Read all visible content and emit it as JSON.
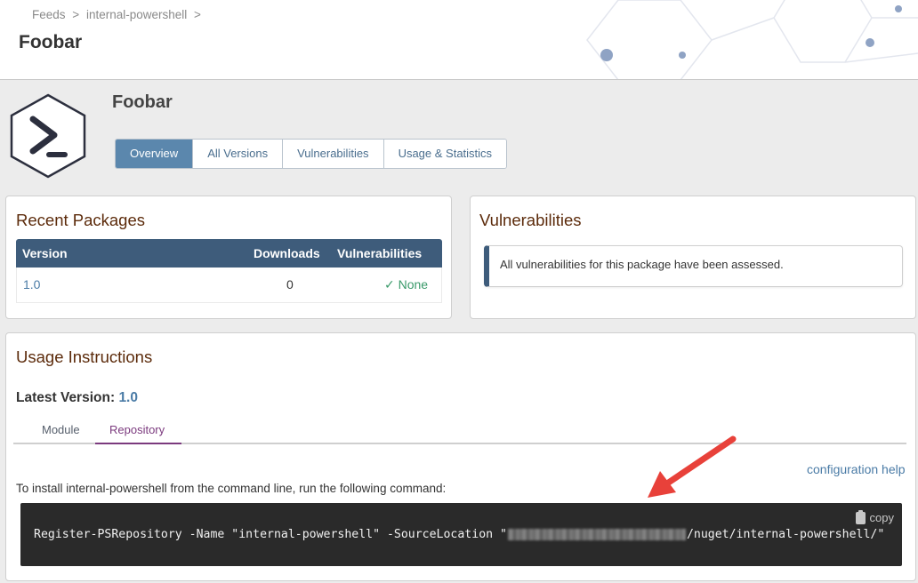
{
  "breadcrumb": {
    "items": [
      "Feeds",
      ">",
      "internal-powershell",
      ">"
    ]
  },
  "page": {
    "title": "Foobar"
  },
  "package": {
    "name": "Foobar",
    "tabs": [
      {
        "label": "Overview",
        "active": true
      },
      {
        "label": "All Versions",
        "active": false
      },
      {
        "label": "Vulnerabilities",
        "active": false
      },
      {
        "label": "Usage & Statistics",
        "active": false
      }
    ]
  },
  "recent": {
    "title": "Recent Packages",
    "columns": [
      "Version",
      "Downloads",
      "Vulnerabilities"
    ],
    "rows": [
      {
        "version": "1.0",
        "downloads": "0",
        "vulnerabilities": "None"
      }
    ]
  },
  "vulnerabilities": {
    "title": "Vulnerabilities",
    "message": "All vulnerabilities for this package have been assessed."
  },
  "usage": {
    "title": "Usage Instructions",
    "latest_label": "Latest Version:",
    "latest_version": "1.0",
    "subtabs": [
      {
        "label": "Module",
        "active": false
      },
      {
        "label": "Repository",
        "active": true
      }
    ],
    "config_help": "configuration help",
    "install_text": "To install internal-powershell from the command line, run the following command:",
    "command_prefix": "Register-PSRepository -Name \"internal-powershell\" -SourceLocation \"",
    "command_suffix": "/nuget/internal-powershell/\"",
    "copy_label": "copy"
  },
  "colors": {
    "accent": "#5b87ad",
    "header_dark": "#3e5c7b",
    "title_brown": "#5c2b0b",
    "annotation_arrow": "#e8413a"
  }
}
